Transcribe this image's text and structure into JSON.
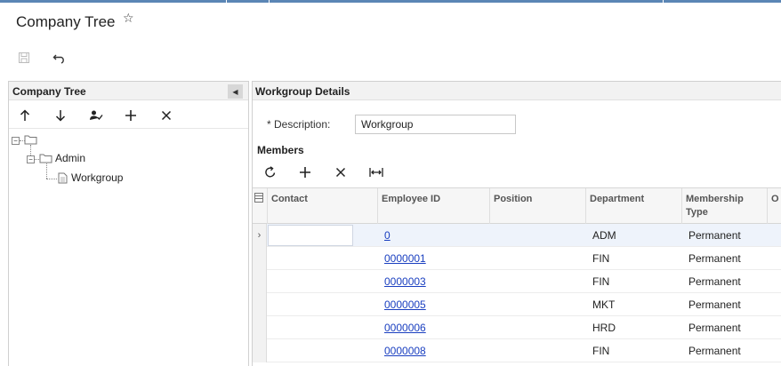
{
  "header": {
    "page_title": "Company Tree",
    "star_icon": "star-outline-icon",
    "toolbar": {
      "save_icon": "save-icon",
      "undo_icon": "undo-icon"
    }
  },
  "tree_panel": {
    "title": "Company Tree",
    "toolbar_icons": [
      "move-up-icon",
      "move-down-icon",
      "user-check-icon",
      "add-icon",
      "delete-icon"
    ],
    "nodes": [
      {
        "label": "",
        "level": 0,
        "expanded": true
      },
      {
        "label": "Admin",
        "level": 1,
        "expanded": true
      },
      {
        "label": "Workgroup",
        "level": 2,
        "expanded": false
      }
    ]
  },
  "details": {
    "title": "Workgroup Details",
    "description_label": "* Description:",
    "description_value": "Workgroup",
    "members_title": "Members",
    "members_toolbar_icons": [
      "refresh-icon",
      "add-icon",
      "delete-icon",
      "fit-columns-icon"
    ],
    "columns": [
      "Contact",
      "Employee ID",
      "Position",
      "Department",
      "Membership Type",
      "O"
    ],
    "rows": [
      {
        "contact": "",
        "employee_id": "0",
        "position": "",
        "department": "ADM",
        "membership_type": "Permanent"
      },
      {
        "contact": "",
        "employee_id": "0000001",
        "position": "",
        "department": "FIN",
        "membership_type": "Permanent"
      },
      {
        "contact": "",
        "employee_id": "0000003",
        "position": "",
        "department": "FIN",
        "membership_type": "Permanent"
      },
      {
        "contact": "",
        "employee_id": "0000005",
        "position": "",
        "department": "MKT",
        "membership_type": "Permanent"
      },
      {
        "contact": "",
        "employee_id": "0000006",
        "position": "",
        "department": "HRD",
        "membership_type": "Permanent"
      },
      {
        "contact": "",
        "employee_id": "0000008",
        "position": "",
        "department": "FIN",
        "membership_type": "Permanent"
      }
    ]
  },
  "colors": {
    "accent": "#5b86b5",
    "link": "#1a3fc0",
    "panel_header": "#f2f2f2",
    "active_row": "#eef3fb"
  }
}
